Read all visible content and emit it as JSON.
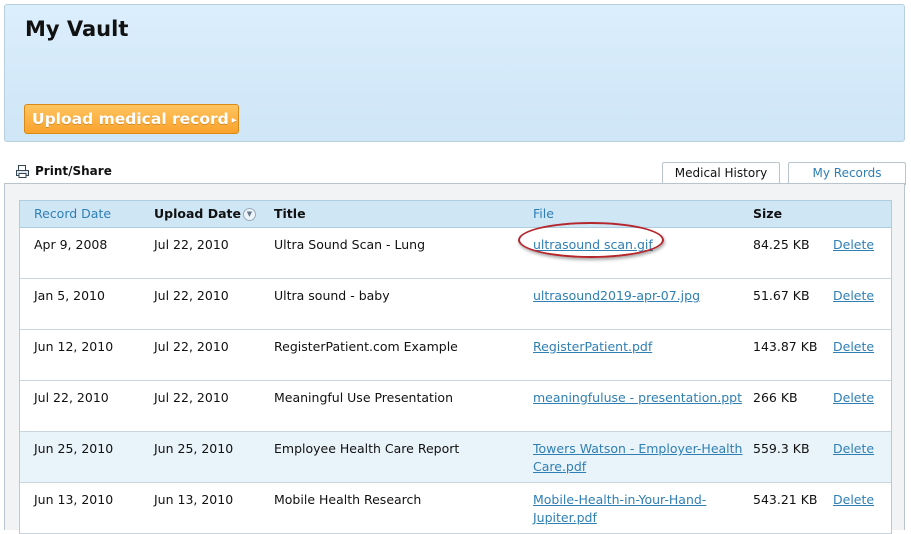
{
  "header": {
    "title": "My Vault",
    "upload_button": "Upload medical record",
    "upload_arrow": "▸"
  },
  "toolbar": {
    "print_share": "Print/Share",
    "icon": "print-icon"
  },
  "tabs": [
    {
      "label": "Medical History",
      "active": false
    },
    {
      "label": "My Records",
      "active": true
    }
  ],
  "table": {
    "columns": {
      "record_date": "Record Date",
      "upload_date": "Upload Date",
      "title": "Title",
      "file": "File",
      "size": "Size"
    },
    "rows": [
      {
        "record_date": "Apr 9, 2008",
        "upload_date": "Jul 22, 2010",
        "title": "Ultra Sound Scan - Lung",
        "file_line1": "ultrasound scan.gif",
        "file_line2": "",
        "size": "84.25 KB",
        "action": "Delete"
      },
      {
        "record_date": "Jan 5, 2010",
        "upload_date": "Jul 22, 2010",
        "title": "Ultra sound - baby",
        "file_line1": "ultrasound2019-apr-07.jpg",
        "file_line2": "",
        "size": "51.67 KB",
        "action": "Delete"
      },
      {
        "record_date": "Jun 12, 2010",
        "upload_date": "Jul 22, 2010",
        "title": "RegisterPatient.com Example",
        "file_line1": "RegisterPatient.pdf",
        "file_line2": "",
        "size": "143.87 KB",
        "action": "Delete"
      },
      {
        "record_date": "Jul 22, 2010",
        "upload_date": "Jul 22, 2010",
        "title": "Meaningful Use Presentation",
        "file_line1": "meaningfuluse - presentation.ppt",
        "file_line2": "",
        "size": "266 KB",
        "action": "Delete"
      },
      {
        "record_date": "Jun 25, 2010",
        "upload_date": "Jun 25, 2010",
        "title": "Employee Health Care Report",
        "file_line1": "Towers Watson - Employer-Health",
        "file_line2": "Care.pdf",
        "size": "559.3 KB",
        "action": "Delete"
      },
      {
        "record_date": "Jun 13, 2010",
        "upload_date": "Jun 13, 2010",
        "title": "Mobile Health Research",
        "file_line1": "Mobile-Health-in-Your-Hand-",
        "file_line2": "Jupiter.pdf",
        "size": "543.21 KB",
        "action": "Delete"
      }
    ]
  },
  "colors": {
    "accent_orange": "#f9a22c",
    "link_blue": "#2f7fb4",
    "header_bg": "#d3e9f9",
    "highlight_ring": "#b5262c"
  }
}
